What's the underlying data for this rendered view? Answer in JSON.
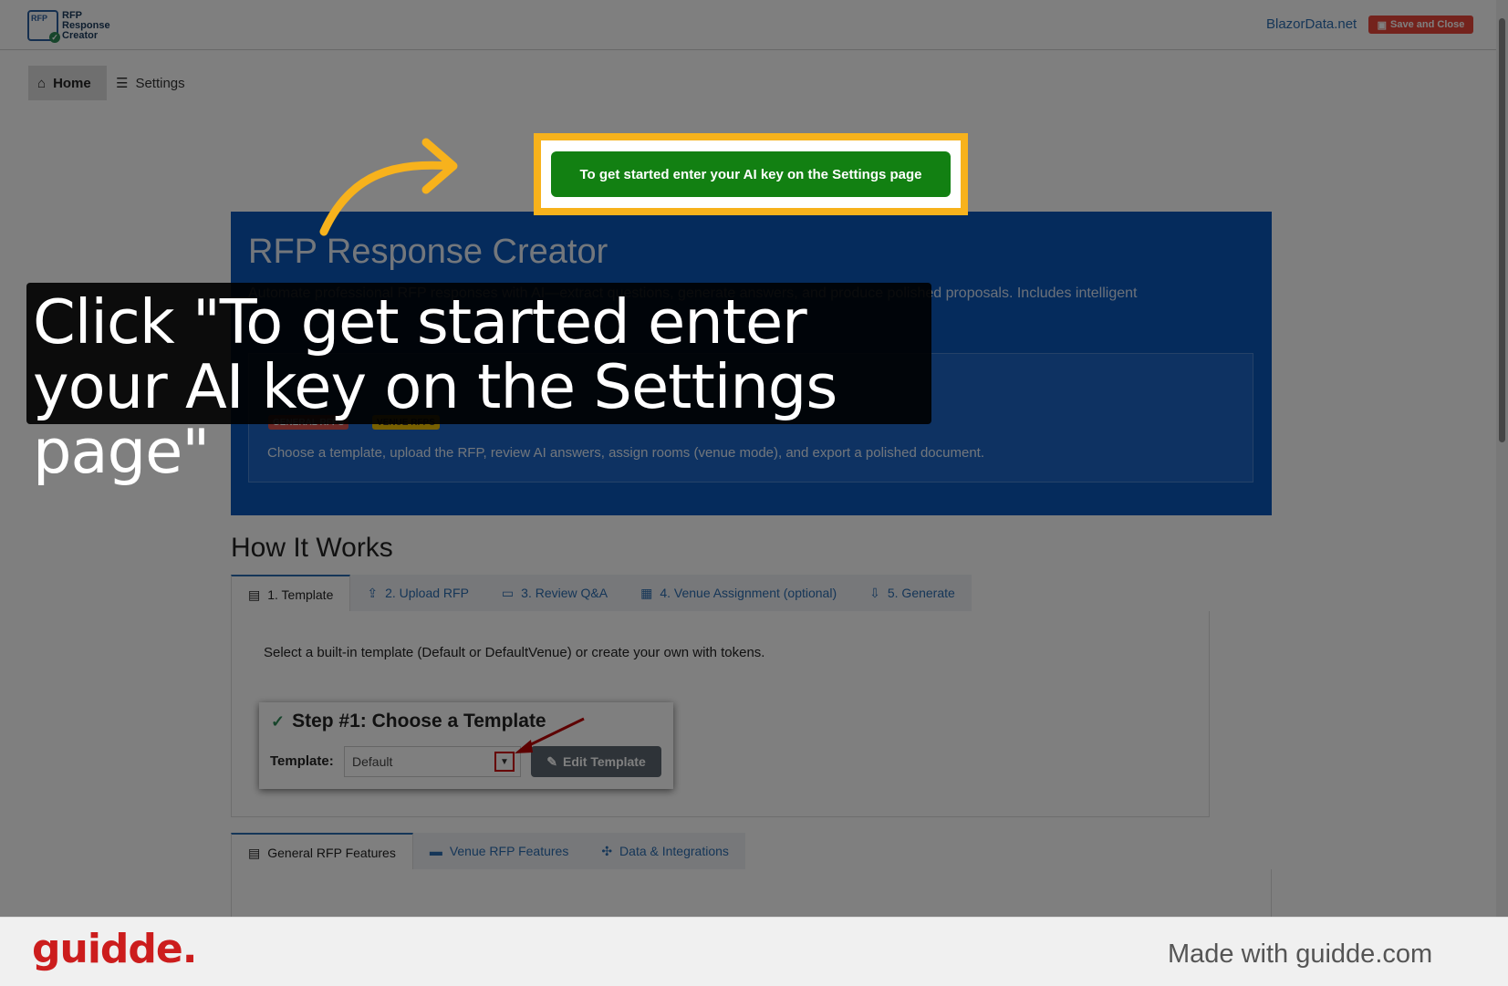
{
  "app": {
    "logo_text_1": "RFP",
    "logo_text_2": "Response",
    "logo_text_3": "Creator",
    "logo_badge": "RFP"
  },
  "header": {
    "link": "BlazorData.net",
    "save_close": "Save and Close"
  },
  "nav": {
    "home": "Home",
    "settings": "Settings"
  },
  "cta": {
    "label": "To get started enter your AI key on the Settings page"
  },
  "hero": {
    "title": "RFP Response Creator",
    "description": "Automate professional RFP responses with AI—extract questions, generate answers, and produce polished proposals. Includes intelligent",
    "badge_general": "GENERAL RFPS",
    "badge_venue": "VENUE RFPS",
    "box_text": "Choose a template, upload the RFP, review AI answers, assign rooms (venue mode), and export a polished document."
  },
  "how_it_works": {
    "heading": "How It Works",
    "tabs": [
      {
        "label": "1. Template"
      },
      {
        "label": "2. Upload RFP"
      },
      {
        "label": "3. Review Q&A"
      },
      {
        "label": "4. Venue Assignment (optional)"
      },
      {
        "label": "5. Generate"
      }
    ],
    "panel_text": "Select a built-in template (Default or DefaultVenue) or create your own with tokens."
  },
  "step_card": {
    "title": "Step #1: Choose a Template",
    "template_label": "Template:",
    "template_value": "Default",
    "edit_button": "Edit Template"
  },
  "features_tabs": [
    {
      "label": "General RFP Features"
    },
    {
      "label": "Venue RFP Features"
    },
    {
      "label": "Data & Integrations"
    }
  ],
  "overlay": {
    "instruction": "Click \"To get started enter your AI key on the Settings page\"",
    "accent_color": "#f7b21c"
  },
  "footer": {
    "brand": "guidde.",
    "made_with": "Made with guidde.com"
  }
}
